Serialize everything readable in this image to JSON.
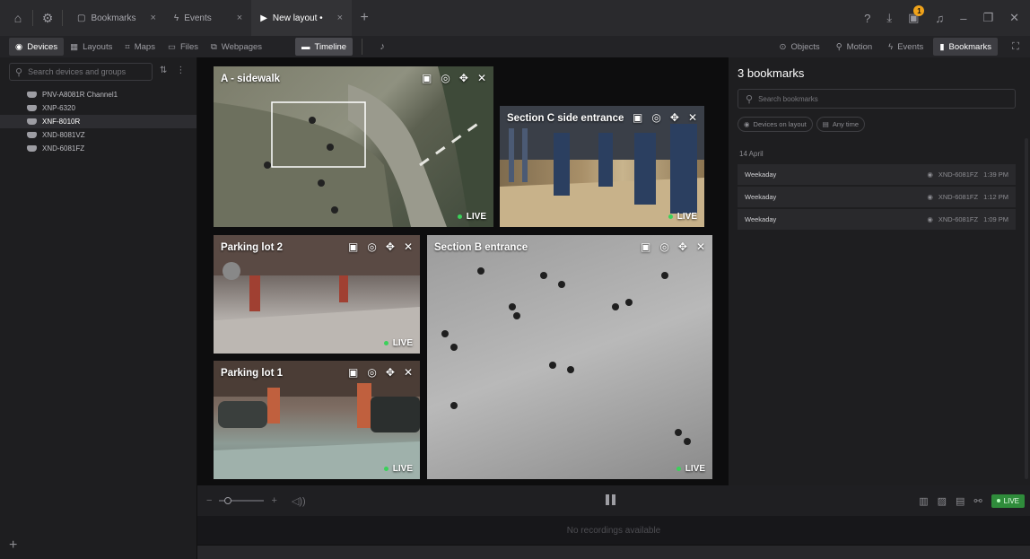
{
  "titlebar": {
    "tabs": [
      {
        "label": "Bookmarks"
      },
      {
        "label": "Events"
      },
      {
        "label": "New layout •"
      }
    ],
    "notification_count": "1"
  },
  "toolbar": {
    "devices": "Devices",
    "layouts": "Layouts",
    "maps": "Maps",
    "files": "Files",
    "webpages": "Webpages",
    "timeline": "Timeline",
    "objects": "Objects",
    "motion": "Motion",
    "events": "Events",
    "bookmarks": "Bookmarks"
  },
  "sidebar": {
    "search_placeholder": "Search devices and groups",
    "devices": [
      {
        "name": "PNV-A8081R Channel1"
      },
      {
        "name": "XNP-6320"
      },
      {
        "name": "XNF-8010R"
      },
      {
        "name": "XND-8081VZ"
      },
      {
        "name": "XND-6081FZ"
      }
    ]
  },
  "tiles": [
    {
      "title": "A - sidewalk",
      "status": "LIVE"
    },
    {
      "title": "Section C side entrance",
      "status": "LIVE"
    },
    {
      "title": "Parking lot 2",
      "status": "LIVE"
    },
    {
      "title": "Section B entrance",
      "status": "LIVE"
    },
    {
      "title": "Parking lot 1",
      "status": "LIVE"
    }
  ],
  "timeline": {
    "empty_text": "No recordings available",
    "live_label": "LIVE"
  },
  "bookmarks": {
    "title": "3 bookmarks",
    "search_placeholder": "Search bookmarks",
    "chip_devices": "Devices on layout",
    "chip_time": "Any time",
    "date": "14 April",
    "items": [
      {
        "name": "Weekaday",
        "device": "XND-6081FZ",
        "time": "1:39 PM"
      },
      {
        "name": "Weekaday",
        "device": "XND-6081FZ",
        "time": "1:12 PM"
      },
      {
        "name": "Weekaday",
        "device": "XND-6081FZ",
        "time": "1:09 PM"
      }
    ]
  },
  "colors": {
    "accent_active": "#e38b2c",
    "live_green": "#3bd15a",
    "notification": "#f0a31a"
  }
}
